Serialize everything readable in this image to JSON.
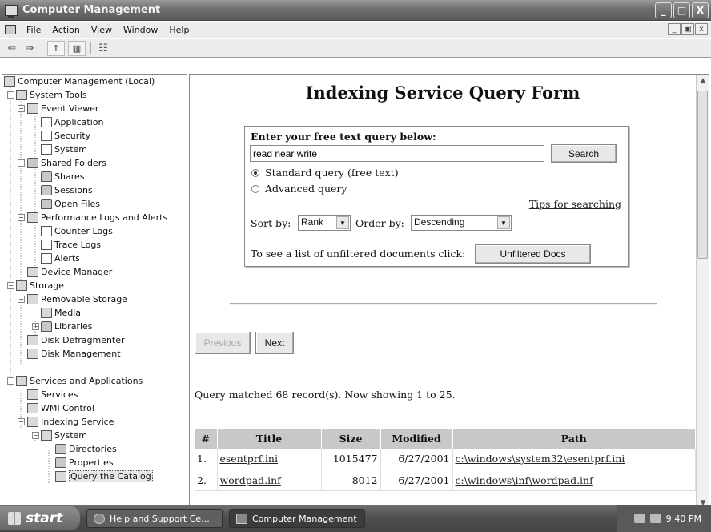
{
  "window": {
    "title": "Computer Management",
    "min": "_",
    "max": "□",
    "close": "X"
  },
  "menu": {
    "items": [
      "File",
      "Action",
      "View",
      "Window",
      "Help"
    ],
    "mdi_min": "_",
    "mdi_max": "▣",
    "mdi_close": "x"
  },
  "toolbar": {
    "back": "⇐",
    "forward": "⇒"
  },
  "tree": {
    "items": [
      {
        "label": "Computer Management (Local)"
      },
      {
        "label": "System Tools"
      },
      {
        "label": "Event Viewer"
      },
      {
        "label": "Application"
      },
      {
        "label": "Security"
      },
      {
        "label": "System"
      },
      {
        "label": "Shared Folders"
      },
      {
        "label": "Shares"
      },
      {
        "label": "Sessions"
      },
      {
        "label": "Open Files"
      },
      {
        "label": "Performance Logs and Alerts"
      },
      {
        "label": "Counter Logs"
      },
      {
        "label": "Trace Logs"
      },
      {
        "label": "Alerts"
      },
      {
        "label": "Device Manager"
      },
      {
        "label": "Storage"
      },
      {
        "label": "Removable Storage"
      },
      {
        "label": "Media"
      },
      {
        "label": "Libraries"
      },
      {
        "label": "Disk Defragmenter"
      },
      {
        "label": "Disk Management"
      },
      {
        "label": "Services and Applications"
      },
      {
        "label": "Services"
      },
      {
        "label": "WMI Control"
      },
      {
        "label": "Indexing Service"
      },
      {
        "label": "System"
      },
      {
        "label": "Directories"
      },
      {
        "label": "Properties"
      },
      {
        "label": "Query the Catalog"
      }
    ]
  },
  "form": {
    "title": "Indexing Service Query Form",
    "prompt": "Enter your free text query below:",
    "query_value": "read near write",
    "search_label": "Search",
    "radio_standard": "Standard query (free text)",
    "radio_advanced": "Advanced query",
    "tips_link": "Tips for searching",
    "sort_label": "Sort by:",
    "sort_value": "Rank",
    "order_label": "Order by:",
    "order_value": "Descending",
    "unfiltered_text": "To see a list of unfiltered documents click:",
    "unfiltered_button": "Unfiltered Docs"
  },
  "nav": {
    "previous": "Previous",
    "next": "Next"
  },
  "results": {
    "summary": "Query matched 68 record(s). Now showing 1 to 25.",
    "headers": [
      "#",
      "Title",
      "Size",
      "Modified",
      "Path"
    ],
    "rows": [
      {
        "num": "1.",
        "title": "esentprf.ini",
        "size": "1015477",
        "modified": "6/27/2001",
        "path": "c:\\windows\\system32\\esentprf.ini"
      },
      {
        "num": "2.",
        "title": "wordpad.inf",
        "size": "8012",
        "modified": "6/27/2001",
        "path": "c:\\windows\\inf\\wordpad.inf"
      }
    ]
  },
  "taskbar": {
    "start": "start",
    "tasks": [
      "Help and Support Ce...",
      "Computer Management"
    ],
    "clock": "9:40 PM"
  }
}
